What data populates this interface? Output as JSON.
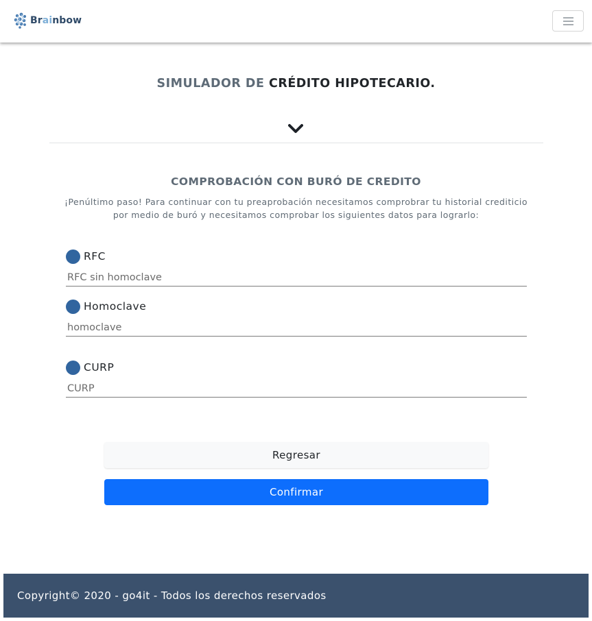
{
  "navbar": {
    "brand_prefix": "Br",
    "brand_ai": "ai",
    "brand_suffix": "nbow",
    "menu_icon": "hamburger-icon"
  },
  "header": {
    "title_part1": "SIMULADOR DE ",
    "title_part2": "CRÉDITO HIPOTECARIO.",
    "scroll_icon": "chevron-down-icon"
  },
  "section": {
    "title": "COMPROBACIÓN CON BURÓ DE CREDITO",
    "description": "¡Penúltimo paso! Para continuar con tu preaprobación necesitamos comprobrar tu historial crediticio por medio de buró y necesitamos comprobar los siguientes datos para lograrlo:"
  },
  "form": {
    "rfc": {
      "label": "RFC",
      "placeholder": "RFC sin homoclave",
      "value": ""
    },
    "homoclave": {
      "label": "Homoclave",
      "placeholder": "homoclave",
      "value": ""
    },
    "curp": {
      "label": "CURP",
      "placeholder": "CURP",
      "value": ""
    }
  },
  "actions": {
    "back_label": "Regresar",
    "confirm_label": "Confirmar"
  },
  "footer": {
    "copyright": "Copyright© 2020 - go4it - Todos los derechos reservados"
  },
  "colors": {
    "accent": "#0d6efd",
    "bullet": "#31659f",
    "footer_bg": "#3b516d"
  }
}
